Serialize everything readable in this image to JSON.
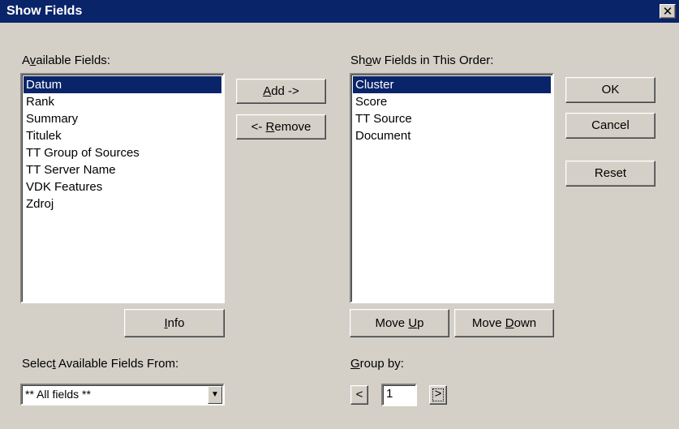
{
  "window": {
    "title": "Show Fields",
    "close_label": "✕"
  },
  "available": {
    "label_pre": "A",
    "label_key": "v",
    "label_post": "ailable Fields:",
    "items": [
      "Datum",
      "Rank",
      "Summary",
      "Titulek",
      "TT Group of Sources",
      "TT Server Name",
      "VDK Features",
      "Zdroj"
    ],
    "selected_index": 0
  },
  "ordered": {
    "label_pre": "Sh",
    "label_key": "o",
    "label_post": "w Fields in This Order:",
    "items": [
      "Cluster",
      "Score",
      "TT Source",
      "Document"
    ],
    "selected_index": 0
  },
  "buttons": {
    "add_key": "A",
    "add_post": "dd ->",
    "remove_pre": "<- ",
    "remove_key": "R",
    "remove_post": "emove",
    "ok": "OK",
    "cancel": "Cancel",
    "reset": "Reset",
    "info_key": "I",
    "info_post": "nfo",
    "move_up_pre": "Move ",
    "move_up_key": "U",
    "move_up_post": "p",
    "move_down_pre": "Move ",
    "move_down_key": "D",
    "move_down_post": "own"
  },
  "select_from": {
    "label_pre": "Selec",
    "label_key": "t",
    "label_post": " Available Fields From:",
    "value": "** All fields **"
  },
  "group_by": {
    "label_key": "G",
    "label_post": "roup by:",
    "prev": "<",
    "value": "1",
    "next": ">"
  }
}
